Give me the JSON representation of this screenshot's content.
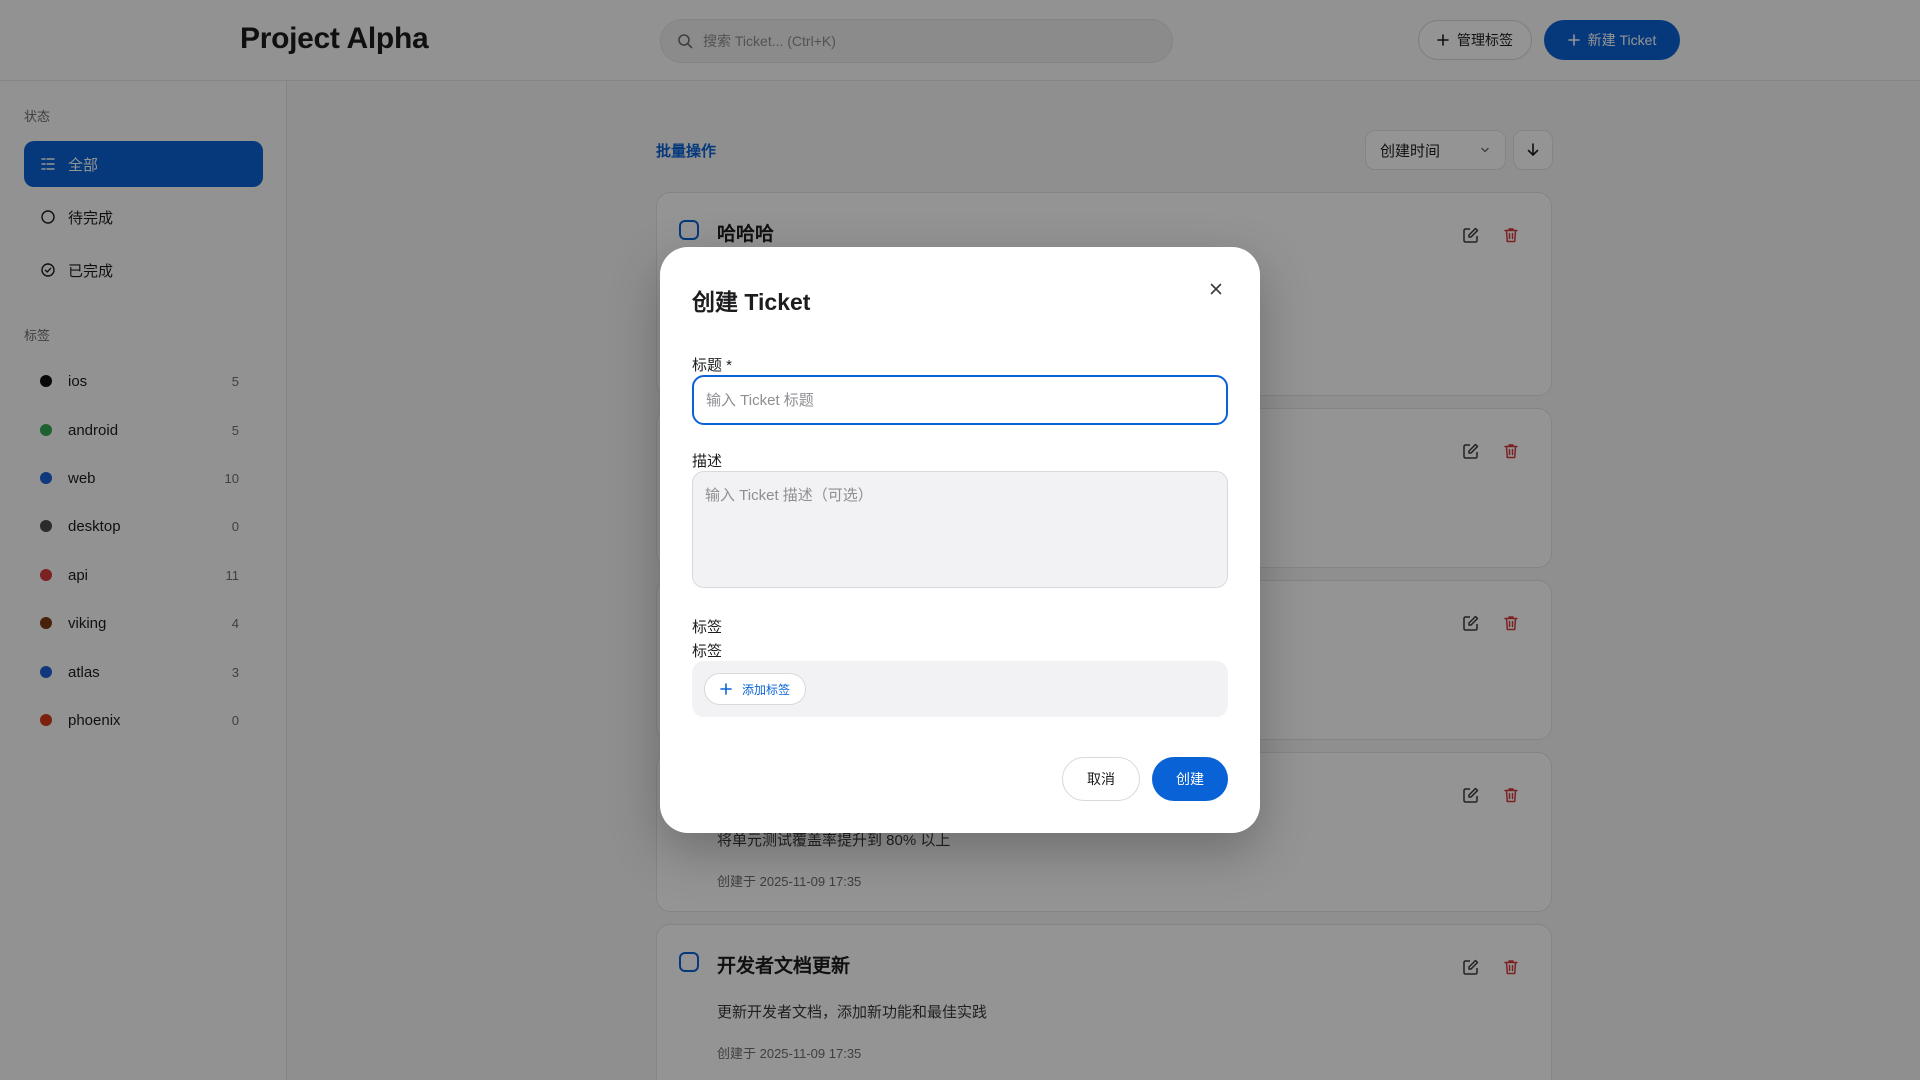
{
  "header": {
    "app_title": "Project Alpha",
    "search_placeholder": "搜索 Ticket... (Ctrl+K)",
    "manage_tags_label": "管理标签",
    "new_ticket_label": "新建 Ticket"
  },
  "sidebar": {
    "status_title": "状态",
    "status_items": [
      {
        "label": "全部",
        "icon": "list-icon",
        "active": true
      },
      {
        "label": "待完成",
        "icon": "circle-icon",
        "active": false
      },
      {
        "label": "已完成",
        "icon": "check-circle-icon",
        "active": false
      }
    ],
    "tags_title": "标签",
    "tags": [
      {
        "name": "ios",
        "count": "5",
        "color": "#111111"
      },
      {
        "name": "android",
        "count": "5",
        "color": "#34a853"
      },
      {
        "name": "web",
        "count": "10",
        "color": "#1a63d6"
      },
      {
        "name": "desktop",
        "count": "0",
        "color": "#4a4a4a"
      },
      {
        "name": "api",
        "count": "11",
        "color": "#d63a3a"
      },
      {
        "name": "viking",
        "count": "4",
        "color": "#7a3c12"
      },
      {
        "name": "atlas",
        "count": "3",
        "color": "#1a63d6"
      },
      {
        "name": "phoenix",
        "count": "0",
        "color": "#d63a1a"
      }
    ]
  },
  "toolbar": {
    "bulk_label": "批量操作",
    "sort_label": "创建时间"
  },
  "tickets": [
    {
      "title": "哈哈哈",
      "description": "",
      "meta": ""
    },
    {
      "title": "",
      "description": "",
      "meta": ""
    },
    {
      "title": "",
      "description": "",
      "meta": ""
    },
    {
      "title": "",
      "description": "将单元测试覆盖率提升到 80% 以上",
      "meta": "创建于 2025-11-09 17:35"
    },
    {
      "title": "开发者文档更新",
      "description": "更新开发者文档，添加新功能和最佳实践",
      "meta": "创建于 2025-11-09 17:35"
    }
  ],
  "modal": {
    "title": "创建 Ticket",
    "title_label": "标题 *",
    "title_placeholder": "输入 Ticket 标题",
    "desc_label": "描述",
    "desc_placeholder": "输入 Ticket 描述（可选）",
    "tags_label_1": "标签",
    "tags_label_2": "标签",
    "add_tag_label": "添加标签",
    "cancel_label": "取消",
    "create_label": "创建"
  },
  "colors": {
    "accent": "#0a63d6",
    "danger": "#d63a3a"
  }
}
